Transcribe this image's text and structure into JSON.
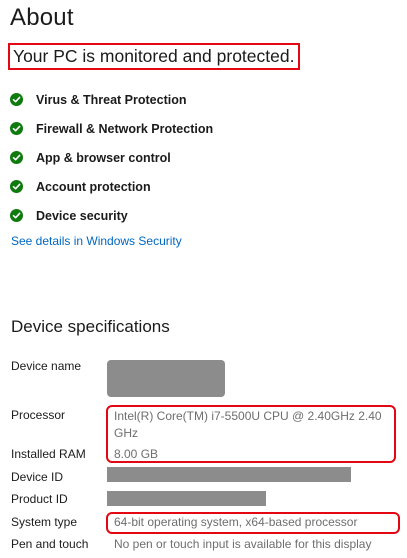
{
  "page": {
    "title": "About"
  },
  "security": {
    "status_heading": "Your PC is monitored and protected.",
    "items": [
      {
        "label": "Virus & Threat Protection",
        "icon": "check-circle-icon"
      },
      {
        "label": "Firewall & Network Protection",
        "icon": "check-circle-icon"
      },
      {
        "label": "App & browser control",
        "icon": "check-circle-icon"
      },
      {
        "label": "Account protection",
        "icon": "check-circle-icon"
      },
      {
        "label": "Device security",
        "icon": "check-circle-icon"
      }
    ],
    "details_link": "See details in Windows Security"
  },
  "specs": {
    "section_title": "Device specifications",
    "device_name": {
      "label": "Device name",
      "value": ""
    },
    "processor": {
      "label": "Processor",
      "value_line1": "Intel(R) Core(TM) i7-5500U CPU @ 2.40GHz   2.40",
      "value_line2": "GHz"
    },
    "installed_ram": {
      "label": "Installed RAM",
      "value": "8.00 GB"
    },
    "device_id": {
      "label": "Device ID",
      "value": ""
    },
    "product_id": {
      "label": "Product ID",
      "value": ""
    },
    "system_type": {
      "label": "System type",
      "value": "64-bit operating system, x64-based processor"
    },
    "pen_touch": {
      "label": "Pen and touch",
      "value": "No pen or touch input is available for this display"
    }
  },
  "colors": {
    "status_ok": "#0f7b0f",
    "link": "#0067c0",
    "annotation": "#e30613",
    "redaction": "#8c8c8c"
  }
}
